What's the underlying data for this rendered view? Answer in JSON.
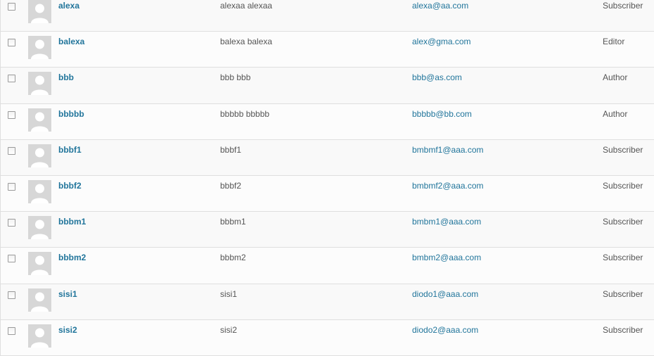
{
  "users": [
    {
      "username": "alexa",
      "name": "alexaa alexaa",
      "email": "alexa@aa.com",
      "role": "Subscriber"
    },
    {
      "username": "balexa",
      "name": "balexa balexa",
      "email": "alex@gma.com",
      "role": "Editor"
    },
    {
      "username": "bbb",
      "name": "bbb bbb",
      "email": "bbb@as.com",
      "role": "Author"
    },
    {
      "username": "bbbbb",
      "name": "bbbbb bbbbb",
      "email": "bbbbb@bb.com",
      "role": "Author"
    },
    {
      "username": "bbbf1",
      "name": "bbbf1",
      "email": "bmbmf1@aaa.com",
      "role": "Subscriber"
    },
    {
      "username": "bbbf2",
      "name": "bbbf2",
      "email": "bmbmf2@aaa.com",
      "role": "Subscriber"
    },
    {
      "username": "bbbm1",
      "name": "bbbm1",
      "email": "bmbm1@aaa.com",
      "role": "Subscriber"
    },
    {
      "username": "bbbm2",
      "name": "bbbm2",
      "email": "bmbm2@aaa.com",
      "role": "Subscriber"
    },
    {
      "username": "sisi1",
      "name": "sisi1",
      "email": "diodo1@aaa.com",
      "role": "Subscriber"
    },
    {
      "username": "sisi2",
      "name": "sisi2",
      "email": "diodo2@aaa.com",
      "role": "Subscriber"
    }
  ],
  "icons": {
    "avatar": "default-avatar-icon",
    "checkbox": "checkbox-icon"
  },
  "colors": {
    "link": "#21759b",
    "text": "#555555",
    "avatar_bg": "#d7d7d7",
    "row_border": "#dfdfdf"
  }
}
